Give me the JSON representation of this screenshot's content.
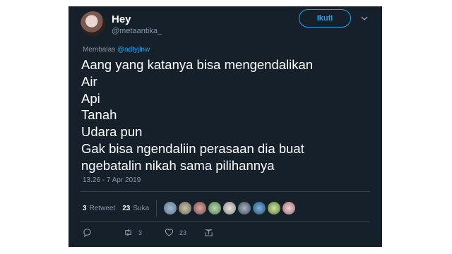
{
  "tweet": {
    "display_name": "Hey",
    "handle": "@metaantika_",
    "follow_label": "Ikuti",
    "reply_prefix": "Membalas",
    "reply_mention": "@adtyjlnw",
    "lines": [
      "Aang yang katanya bisa mengendalikan",
      "Air",
      "Api",
      "Tanah",
      "Udara pun",
      "Gak bisa ngendaliin perasaan dia buat",
      "ngebatalin nikah sama pilihannya"
    ],
    "timestamp": "13.26 - 7 Apr 2019"
  },
  "stats": {
    "retweets_count": "3",
    "retweets_label": "Retweet",
    "likes_count": "23",
    "likes_label": "Suka",
    "liker_avatars": [
      "avatar-1",
      "avatar-2",
      "avatar-3",
      "avatar-4",
      "avatar-5",
      "avatar-6",
      "avatar-7",
      "avatar-8",
      "avatar-9"
    ]
  },
  "actions": {
    "reply_icon": "comment-icon",
    "retweet_icon": "retweet-icon",
    "retweet_count": "3",
    "like_icon": "heart-icon",
    "like_count": "23",
    "share_icon": "share-icon"
  },
  "colors": {
    "background": "#15202b",
    "accent": "#1da1f2",
    "muted_text": "#8899a6",
    "divider": "#38444d"
  }
}
